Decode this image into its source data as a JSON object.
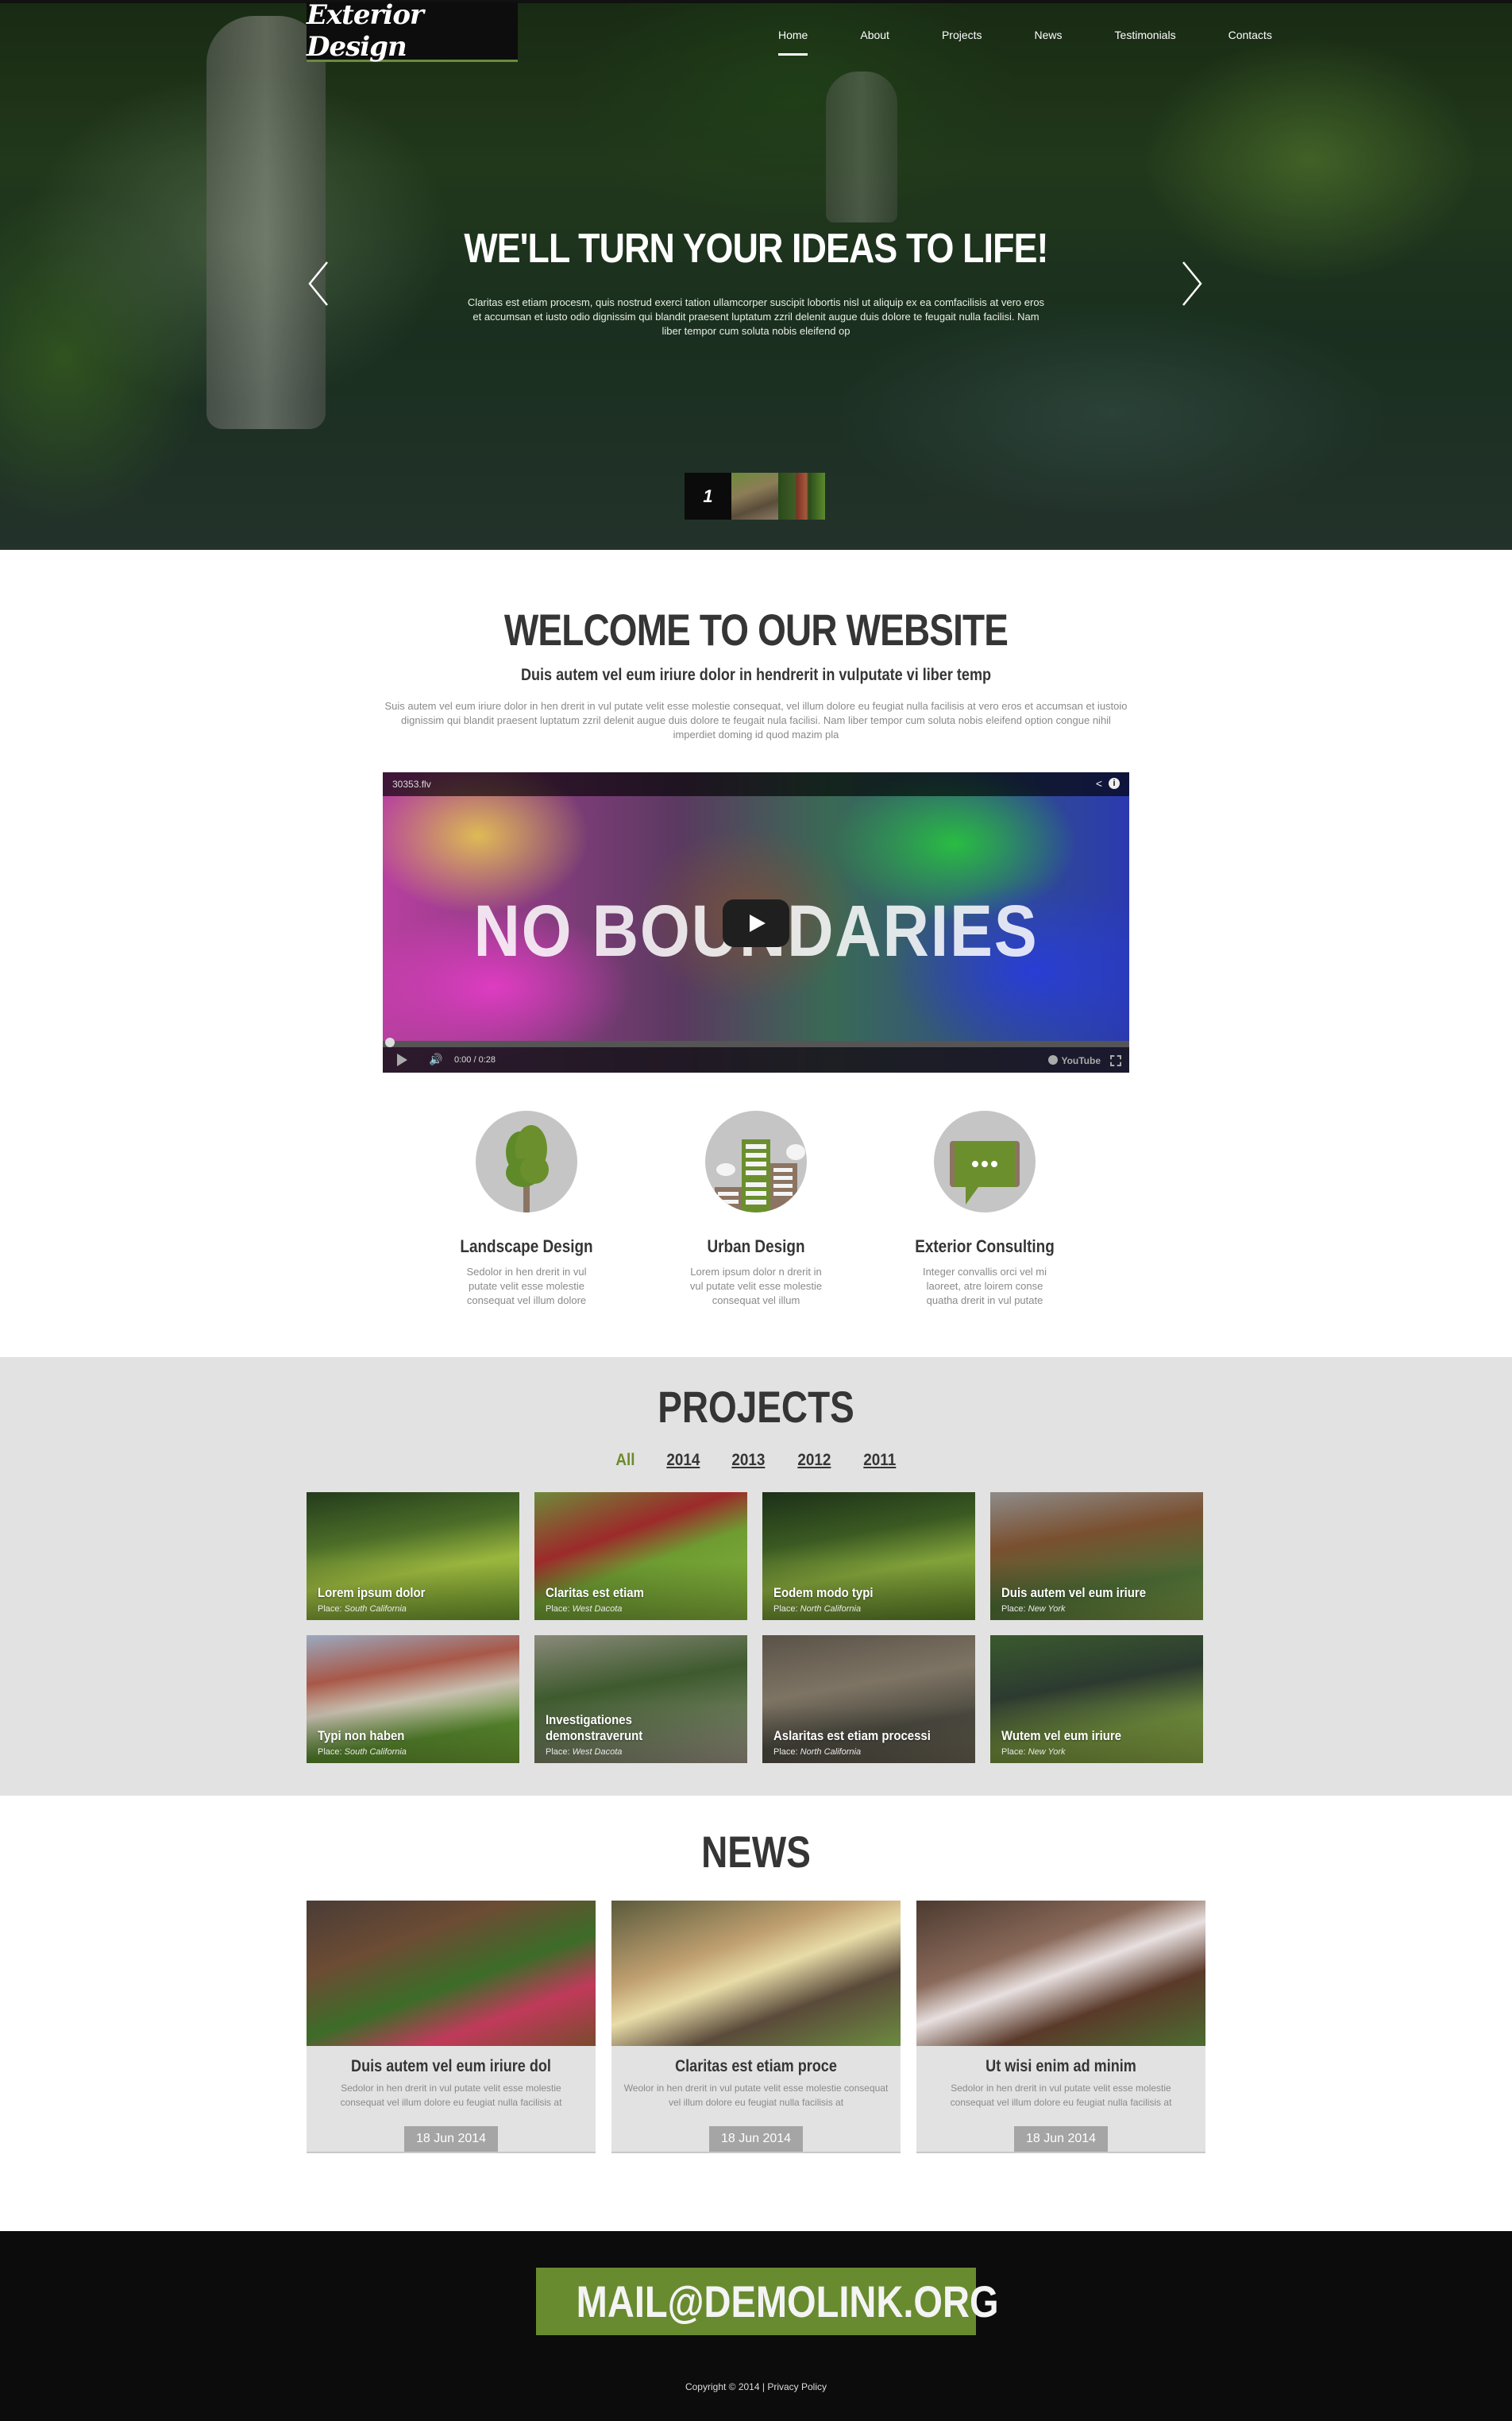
{
  "header": {
    "logo": "Exterior Design",
    "nav": [
      {
        "label": "Home",
        "active": true
      },
      {
        "label": "About"
      },
      {
        "label": "Projects"
      },
      {
        "label": "News"
      },
      {
        "label": "Testimonials"
      },
      {
        "label": "Contacts"
      }
    ]
  },
  "hero": {
    "title": "WE'LL TURN YOUR IDEAS TO LIFE!",
    "text": "Claritas est etiam procesm, quis nostrud exerci tation ullamcorper suscipit lobortis nisl ut aliquip ex ea comfacilisis at vero eros et accumsan et iusto odio dignissim qui blandit praesent luptatum zzril delenit augue duis dolore te feugait nulla facilisi. Nam liber tempor cum soluta nobis eleifend op",
    "slide_number": "1",
    "icons": {
      "prev": "chevron-left-icon",
      "next": "chevron-right-icon"
    }
  },
  "welcome": {
    "title": "WELCOME TO OUR WEBSITE",
    "subtitle": "Duis autem vel eum iriure dolor in hendrerit in vulputate vi liber temp",
    "text": "Suis autem vel eum iriure dolor in hen drerit in vul putate velit esse molestie consequat, vel illum dolore eu feugiat nulla facilisis at vero eros et accumsan et iustoio dignissim qui blandit praesent luptatum zzril delenit augue duis dolore te feugait nula facilisi. Nam liber tempor cum soluta nobis eleifend option congue nihil imperdiet doming id quod mazim pla"
  },
  "video": {
    "title": "30353.flv",
    "overlay_text": "NO BOUNDARIES",
    "time": "0:00 / 0:28",
    "progress": 0,
    "brand": "YouTube"
  },
  "services": [
    {
      "title": "Landscape Design",
      "text": "Sedolor in hen drerit in vul putate velit esse molestie consequat vel illum dolore",
      "icon": "tree-icon"
    },
    {
      "title": "Urban Design",
      "text": "Lorem ipsum dolor n drerit in vul putate velit esse molestie consequat vel illum",
      "icon": "buildings-icon"
    },
    {
      "title": "Exterior Consulting",
      "text": "Integer convallis orci vel mi laoreet, atre loirem conse quatha drerit in vul putate",
      "icon": "chat-bubble-icon"
    }
  ],
  "projects": {
    "title": "PROJECTS",
    "filters": [
      {
        "label": "All",
        "active": true
      },
      {
        "label": "2014"
      },
      {
        "label": "2013"
      },
      {
        "label": "2012"
      },
      {
        "label": "2011"
      }
    ],
    "place_label": "Place:",
    "items": [
      {
        "title": "Lorem ipsum dolor",
        "place": "South California"
      },
      {
        "title": "Claritas est etiam",
        "place": "West Dacota"
      },
      {
        "title": "Eodem modo typi",
        "place": "North California"
      },
      {
        "title": "Duis autem vel eum iriure",
        "place": "New York"
      },
      {
        "title": "Typi non haben",
        "place": "South California"
      },
      {
        "title": "Investigationes demonstraverunt",
        "place": "West Dacota"
      },
      {
        "title": "Aslaritas est etiam processi",
        "place": "North California"
      },
      {
        "title": "Wutem vel eum iriure",
        "place": "New York"
      }
    ]
  },
  "news": {
    "title": "NEWS",
    "items": [
      {
        "title": "Duis autem vel eum iriure dol",
        "text": "Sedolor in hen drerit in vul putate velit esse molestie consequat vel illum dolore eu feugiat nulla facilisis at",
        "date": "18 Jun 2014"
      },
      {
        "title": "Claritas est etiam proce",
        "text": "Weolor in hen drerit in vul putate velit esse molestie consequat vel illum dolore eu feugiat nulla facilisis at",
        "date": "18 Jun 2014"
      },
      {
        "title": "Ut wisi enim ad minim",
        "text": "Sedolor in hen drerit in vul putate velit esse molestie consequat vel illum dolore eu feugiat nulla facilisis at",
        "date": "18 Jun 2014"
      }
    ]
  },
  "footer": {
    "email": "MAIL@DEMOLINK.ORG",
    "copyright": "Copyright © 2014 |",
    "privacy": "Privacy Policy"
  },
  "colors": {
    "accent": "#698b2f",
    "dark": "#0c0c0c",
    "gray_bg": "#e2e2e2",
    "heading": "#353535"
  }
}
